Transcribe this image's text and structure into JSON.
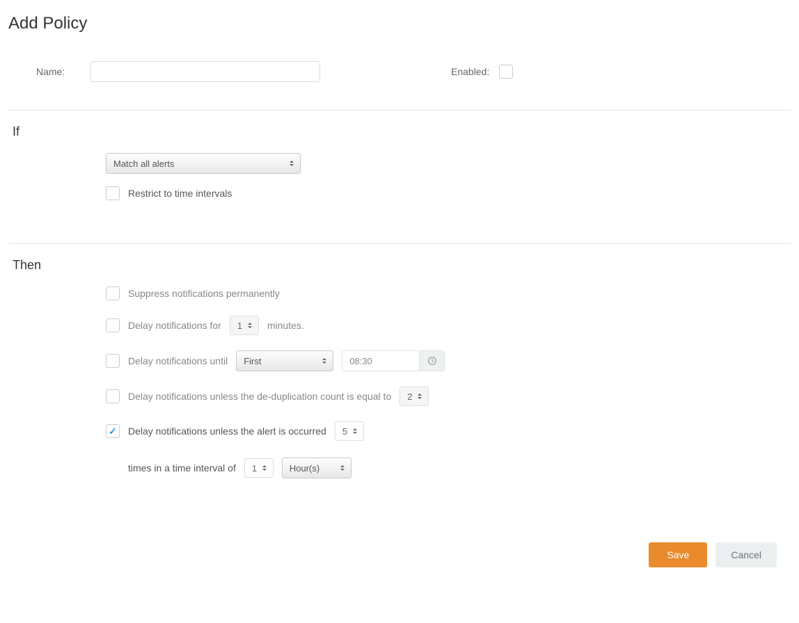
{
  "page": {
    "title": "Add Policy"
  },
  "header": {
    "name_label": "Name:",
    "name_value": "",
    "enabled_label": "Enabled:",
    "enabled_checked": false
  },
  "if_section": {
    "heading": "If",
    "match_selected": "Match all alerts",
    "restrict_label": "Restrict to time intervals",
    "restrict_checked": false
  },
  "then_section": {
    "heading": "Then",
    "suppress": {
      "checked": false,
      "label": "Suppress notifications permanently"
    },
    "delay_for": {
      "checked": false,
      "label_pre": "Delay notifications for",
      "minutes": "1",
      "label_post": "minutes."
    },
    "delay_until": {
      "checked": false,
      "label": "Delay notifications until",
      "when": "First",
      "time": "08:30"
    },
    "dedup": {
      "checked": false,
      "label": "Delay notifications unless the de-duplication count is equal to",
      "count": "2"
    },
    "occurrence": {
      "checked": true,
      "label_pre": "Delay notifications unless the alert is occurred",
      "times": "5",
      "label_mid": "times in a time interval of",
      "interval": "1",
      "unit": "Hour(s)"
    }
  },
  "buttons": {
    "save": "Save",
    "cancel": "Cancel"
  }
}
